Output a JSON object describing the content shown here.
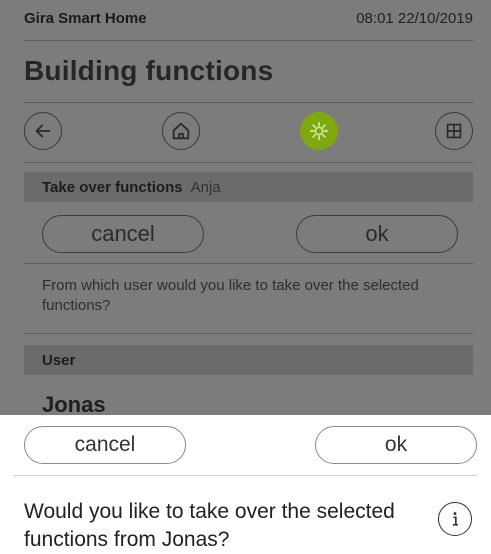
{
  "status": {
    "app_name": "Gira Smart Home",
    "datetime": "08:01 22/10/2019"
  },
  "page": {
    "title": "Building functions"
  },
  "icons": [
    "back-arrow-icon",
    "home-icon",
    "gear-icon",
    "grid-icon"
  ],
  "takeover": {
    "label": "Take over functions",
    "user": "Anja"
  },
  "buttons_bg": {
    "cancel": "cancel",
    "ok": "ok"
  },
  "question_bg": "From which user would you like to take over the selected functions?",
  "user_section": {
    "label": "User",
    "selected": "Jonas"
  },
  "dialog": {
    "cancel": "cancel",
    "ok": "ok",
    "question": "Would you like to take over the selected functions from Jonas?",
    "info_icon": "info-icon"
  },
  "colors": {
    "accent": "#7ea80e",
    "dim_overlay": "#7c7c7c"
  }
}
